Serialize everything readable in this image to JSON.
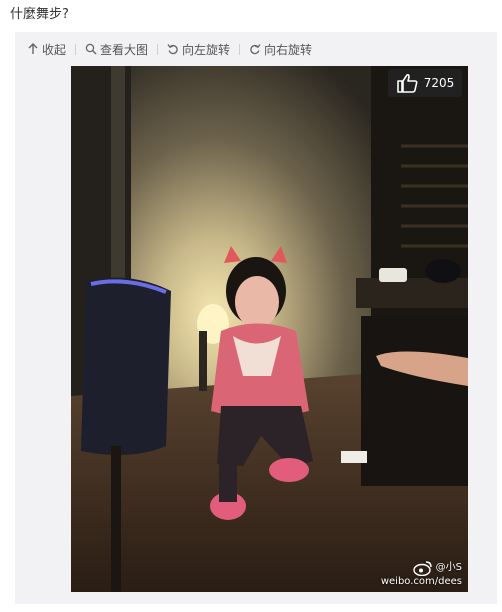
{
  "post": {
    "text": "什麼舞步?"
  },
  "toolbar": {
    "collapse_label": "收起",
    "view_large_label": "查看大图",
    "rotate_left_label": "向左旋转",
    "rotate_right_label": "向右旋转"
  },
  "photo": {
    "like_count": "7205",
    "watermark_handle": "@小S",
    "watermark_site": "weibo.com/dees"
  },
  "colors": {
    "media_background": "#f2f2f5",
    "badge_background": "#232323",
    "text": "#333333"
  },
  "icons": [
    "arrow-up-icon",
    "search-icon",
    "rotate-left-icon",
    "rotate-right-icon",
    "thumbs-up-icon",
    "weibo-logo-icon"
  ]
}
